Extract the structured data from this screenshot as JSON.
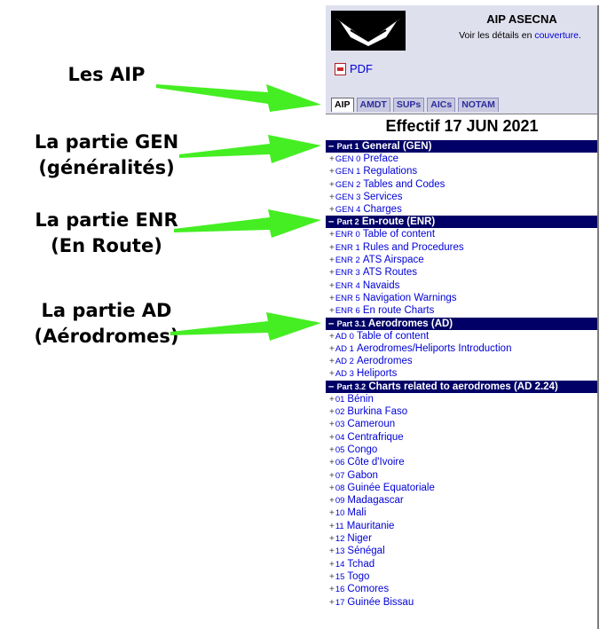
{
  "annotations": [
    {
      "id": "aip",
      "lines": [
        "Les AIP"
      ]
    },
    {
      "id": "gen",
      "lines": [
        "La partie GEN",
        "(généralités)"
      ]
    },
    {
      "id": "enr",
      "lines": [
        "La partie ENR",
        "(En Route)"
      ]
    },
    {
      "id": "ad",
      "lines": [
        "La partie AD",
        "(Aérodromes)"
      ]
    }
  ],
  "header": {
    "title": "AIP ASECNA",
    "detail_prefix": "Voir les détails en",
    "detail_link": "couverture",
    "detail_suffix": ".",
    "pdf_label": "PDF"
  },
  "tabs": [
    {
      "label": "AIP",
      "active": true
    },
    {
      "label": "AMDT",
      "active": false
    },
    {
      "label": "SUPs",
      "active": false
    },
    {
      "label": "AICs",
      "active": false
    },
    {
      "label": "NOTAM",
      "active": false
    }
  ],
  "effectif": "Effectif 17 JUN 2021",
  "parts": [
    {
      "prefix": "–",
      "num": "Part 1",
      "title": "General (GEN)",
      "items": [
        {
          "code": "GEN 0",
          "label": "Preface"
        },
        {
          "code": "GEN 1",
          "label": "Regulations"
        },
        {
          "code": "GEN 2",
          "label": "Tables and Codes"
        },
        {
          "code": "GEN 3",
          "label": "Services"
        },
        {
          "code": "GEN 4",
          "label": "Charges"
        }
      ]
    },
    {
      "prefix": "–",
      "num": "Part 2",
      "title": "En-route (ENR)",
      "items": [
        {
          "code": "ENR 0",
          "label": "Table of content"
        },
        {
          "code": "ENR 1",
          "label": "Rules and Procedures"
        },
        {
          "code": "ENR 2",
          "label": "ATS Airspace"
        },
        {
          "code": "ENR 3",
          "label": "ATS Routes"
        },
        {
          "code": "ENR 4",
          "label": "Navaids"
        },
        {
          "code": "ENR 5",
          "label": "Navigation Warnings"
        },
        {
          "code": "ENR 6",
          "label": "En route Charts"
        }
      ]
    },
    {
      "prefix": "–",
      "num": "Part 3.1",
      "title": "Aerodromes (AD)",
      "items": [
        {
          "code": "AD 0",
          "label": "Table of content"
        },
        {
          "code": "AD 1",
          "label": "Aerodromes/Heliports Introduction"
        },
        {
          "code": "AD 2",
          "label": "Aerodromes"
        },
        {
          "code": "AD 3",
          "label": "Heliports"
        }
      ]
    },
    {
      "prefix": "–",
      "num": "Part 3.2",
      "title": "Charts related to aerodromes (AD 2.24)",
      "items": [
        {
          "code": "01",
          "label": "Bénin"
        },
        {
          "code": "02",
          "label": "Burkina Faso"
        },
        {
          "code": "03",
          "label": "Cameroun"
        },
        {
          "code": "04",
          "label": "Centrafrique"
        },
        {
          "code": "05",
          "label": "Congo"
        },
        {
          "code": "06",
          "label": "Côte d'Ivoire"
        },
        {
          "code": "07",
          "label": "Gabon"
        },
        {
          "code": "08",
          "label": "Guinée Equatoriale"
        },
        {
          "code": "09",
          "label": "Madagascar"
        },
        {
          "code": "10",
          "label": "Mali"
        },
        {
          "code": "11",
          "label": "Mauritanie"
        },
        {
          "code": "12",
          "label": "Niger"
        },
        {
          "code": "13",
          "label": "Sénégal"
        },
        {
          "code": "14",
          "label": "Tchad"
        },
        {
          "code": "15",
          "label": "Togo"
        },
        {
          "code": "16",
          "label": "Comores"
        },
        {
          "code": "17",
          "label": "Guinée Bissau"
        }
      ]
    }
  ],
  "colors": {
    "arrow": "#44ee22",
    "part_bar": "#000066",
    "link": "#0000d8",
    "header_bg": "#dfe0ee"
  },
  "icons": [
    "logo",
    "pdf-icon",
    "arrow-icon"
  ]
}
